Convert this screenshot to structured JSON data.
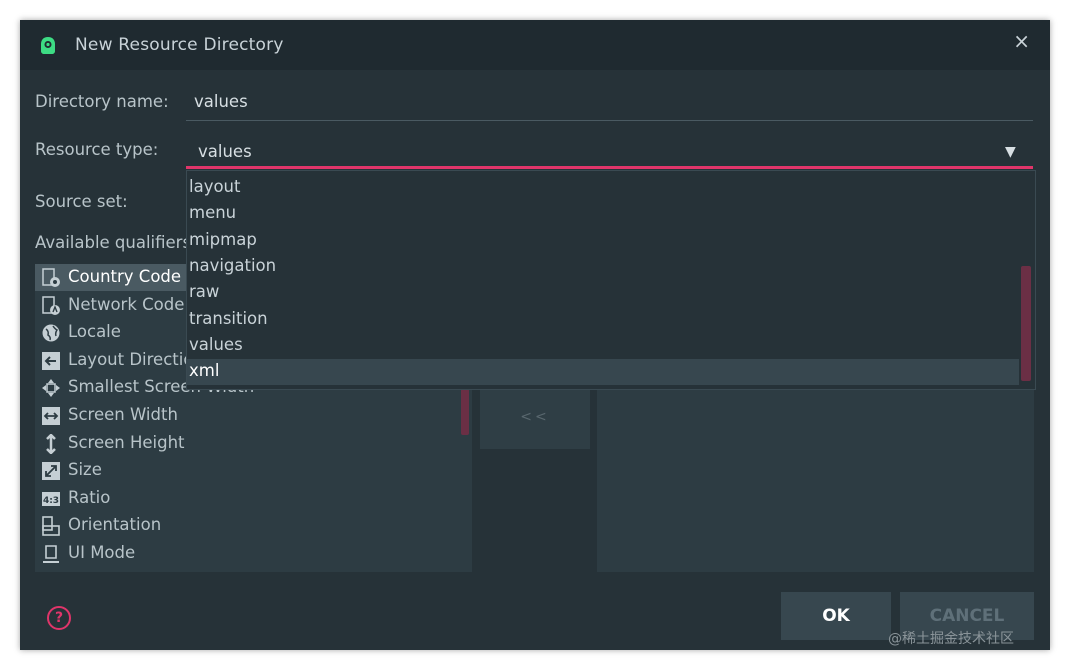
{
  "window": {
    "title": "New Resource Directory",
    "close_glyph": "×"
  },
  "form": {
    "directory_name_label": "Directory name:",
    "directory_name_value": "values",
    "resource_type_label": "Resource type:",
    "resource_type_value": "values",
    "dropdown_arrow": "▼",
    "source_set_label": "Source set:",
    "available_qualifiers_label": "Available qualifiers:"
  },
  "resource_type_options": [
    "layout",
    "menu",
    "mipmap",
    "navigation",
    "raw",
    "transition",
    "values",
    "xml"
  ],
  "resource_type_highlighted": "xml",
  "qualifiers": [
    {
      "label": "Country Code",
      "icon": "country-code-icon"
    },
    {
      "label": "Network Code",
      "icon": "network-code-icon"
    },
    {
      "label": "Locale",
      "icon": "globe-icon"
    },
    {
      "label": "Layout Direction",
      "icon": "layout-direction-icon"
    },
    {
      "label": "Smallest Screen Width",
      "icon": "smallest-width-icon"
    },
    {
      "label": "Screen Width",
      "icon": "screen-width-icon"
    },
    {
      "label": "Screen Height",
      "icon": "screen-height-icon"
    },
    {
      "label": "Size",
      "icon": "size-icon"
    },
    {
      "label": "Ratio",
      "icon": "ratio-icon"
    },
    {
      "label": "Orientation",
      "icon": "orientation-icon"
    },
    {
      "label": "UI Mode",
      "icon": "ui-mode-icon"
    }
  ],
  "selected_qualifier": "Country Code",
  "move_button_label": "<<",
  "buttons": {
    "ok": "OK",
    "cancel": "CANCEL"
  },
  "help_glyph": "?",
  "watermark": "@稀土掘金技术社区",
  "colors": {
    "accent": "#e0356a",
    "background": "#263238",
    "titlebar": "#1f2a30"
  }
}
